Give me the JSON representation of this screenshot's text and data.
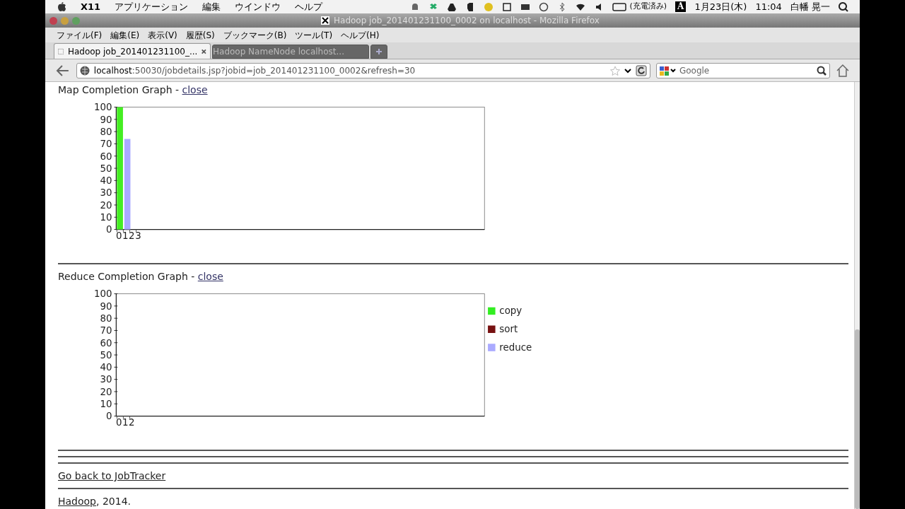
{
  "mac_menubar": {
    "app": "X11",
    "menus": [
      "アプリケーション",
      "編集",
      "ウインドウ",
      "ヘルプ"
    ],
    "battery": "(充電済み)",
    "input_mode": "A",
    "date": "1月23日(木)",
    "time": "11:04",
    "user": "白幡 晃一"
  },
  "window": {
    "title": "Hadoop job_201401231100_0002 on localhost - Mozilla Firefox"
  },
  "menus": [
    "ファイル(F)",
    "編集(E)",
    "表示(V)",
    "履歴(S)",
    "ブックマーク(B)",
    "ツール(T)",
    "ヘルプ(H)"
  ],
  "tabs": [
    {
      "label": "Hadoop job_201401231100_...",
      "selected": true
    },
    {
      "label": "Hadoop NameNode localhost...",
      "selected": false
    }
  ],
  "address": {
    "host": "localhost",
    "path": ":50030/jobdetails.jsp?jobid=job_201401231100_0002&refresh=30"
  },
  "search": {
    "placeholder": "Google"
  },
  "sections": [
    {
      "title": "Map Completion Graph - ",
      "link": "close",
      "chart_data": {
        "type": "bar",
        "categories": [
          "0",
          "1",
          "2",
          "3"
        ],
        "ylim": [
          0,
          100
        ],
        "yticks": [
          0,
          10,
          20,
          30,
          40,
          50,
          60,
          70,
          80,
          90,
          100
        ],
        "series": [
          {
            "color": "#44ee22",
            "values": [
              100,
              null,
              null,
              null
            ]
          },
          {
            "color": "#aaaaff",
            "values": [
              null,
              74,
              null,
              null
            ]
          }
        ]
      }
    },
    {
      "title": "Reduce Completion Graph - ",
      "link": "close",
      "chart_data": {
        "type": "bar",
        "categories": [
          "0",
          "1",
          "2"
        ],
        "ylim": [
          0,
          100
        ],
        "yticks": [
          0,
          10,
          20,
          30,
          40,
          50,
          60,
          70,
          80,
          90,
          100
        ],
        "series": [
          {
            "name": "copy",
            "color": "#33ee22",
            "values": [
              0,
              0,
              0
            ]
          },
          {
            "name": "sort",
            "color": "#771111",
            "values": [
              0,
              0,
              0
            ]
          },
          {
            "name": "reduce",
            "color": "#aaaaff",
            "values": [
              0,
              0,
              0
            ]
          }
        ]
      }
    }
  ],
  "back_link": "Go back to JobTracker",
  "footer": {
    "link": "Hadoop",
    "text": ", 2014."
  }
}
